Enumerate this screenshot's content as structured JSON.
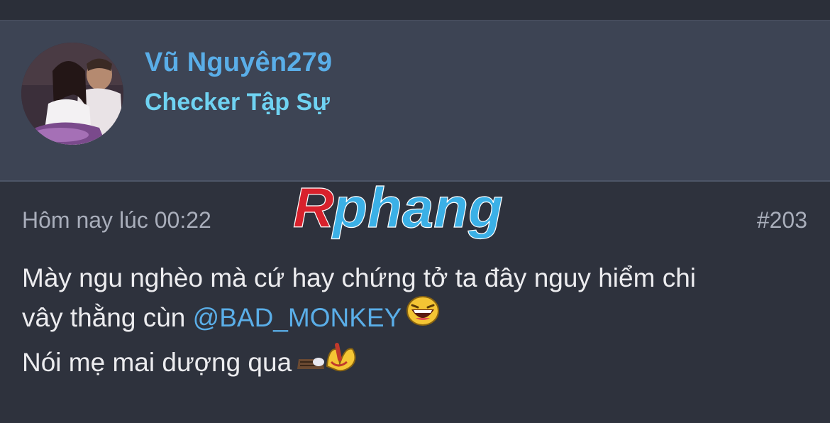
{
  "user": {
    "username": "Vũ Nguyên279",
    "title": "Checker Tập Sự"
  },
  "post": {
    "timestamp": "Hôm nay lúc 00:22",
    "number": "#203",
    "line1": "Mày ngu nghèo mà cứ hay chứng tở ta đây nguy hiểm chi",
    "line2_text": "vây thằng cùn ",
    "mention": "@BAD_MONKEY",
    "line3": "Nói mẹ mai dượng qua"
  },
  "watermark": {
    "text": "Rphang"
  },
  "icons": {
    "avatar": "user-avatar-photo",
    "smiley1": "laughing-emoji-icon",
    "smiley2": "smash-emoji-icon"
  },
  "colors": {
    "username": "#5aaee8",
    "user_title": "#6fd3f2",
    "mention": "#5aaee8",
    "card_bg": "#3d4454",
    "page_bg": "#2e323d",
    "watermark_red": "#d8212c",
    "watermark_blue": "#3bb0e6"
  }
}
